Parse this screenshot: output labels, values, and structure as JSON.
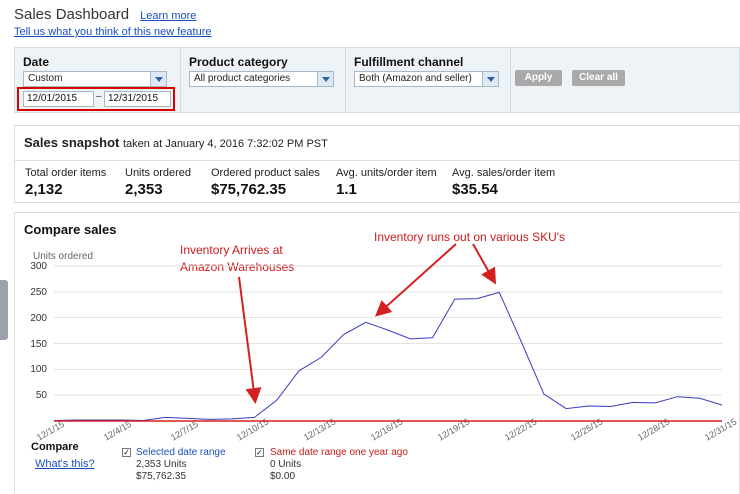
{
  "header": {
    "title": "Sales Dashboard",
    "learn_more": "Learn more",
    "feedback": "Tell us what you think of this new feature"
  },
  "filters": {
    "date": {
      "label": "Date",
      "selected": "Custom",
      "start": "12/01/2015",
      "separator": "–",
      "end": "12/31/2015"
    },
    "category": {
      "label": "Product category",
      "selected": "All product categories"
    },
    "fulfillment": {
      "label": "Fulfillment channel",
      "selected": "Both (Amazon and seller)"
    },
    "apply": "Apply",
    "clear": "Clear all"
  },
  "snapshot": {
    "title": "Sales snapshot",
    "taken": "taken at January 4, 2016 7:32:02 PM PST",
    "metrics": [
      {
        "label": "Total order items",
        "value": "2,132"
      },
      {
        "label": "Units ordered",
        "value": "2,353"
      },
      {
        "label": "Ordered product sales",
        "value": "$75,762.35"
      },
      {
        "label": "Avg. units/order item",
        "value": "1.1"
      },
      {
        "label": "Avg. sales/order item",
        "value": "$35.54"
      }
    ]
  },
  "compare": {
    "title": "Compare sales",
    "label": "Compare",
    "whats_this": "What's this?",
    "selected": {
      "name": "Selected date range",
      "units": "2,353 Units",
      "sales": "$75,762.35"
    },
    "last_year": {
      "name": "Same date range one year ago",
      "units": "0 Units",
      "sales": "$0.00"
    }
  },
  "annotations": {
    "arrives_line1": "Inventory Arrives at",
    "arrives_line2": "Amazon Warehouses",
    "runs_out": "Inventory runs out on various SKU's"
  },
  "colors": {
    "selected": "#3b3bc0",
    "last_year": "#d42020",
    "annotation": "#cc1a1a",
    "link": "#1a4ec0"
  },
  "chart_data": {
    "type": "line",
    "ylabel": "Units ordered",
    "ylim": [
      0,
      300
    ],
    "yticks": [
      50,
      100,
      150,
      200,
      250,
      300
    ],
    "xtick_labels": [
      "12/1/15",
      "12/4/15",
      "12/7/15",
      "12/10/15",
      "12/13/15",
      "12/16/15",
      "12/19/15",
      "12/22/15",
      "12/25/15",
      "12/28/15",
      "12/31/15"
    ],
    "x": [
      "12/1",
      "12/2",
      "12/3",
      "12/4",
      "12/5",
      "12/6",
      "12/7",
      "12/8",
      "12/9",
      "12/10",
      "12/11",
      "12/12",
      "12/13",
      "12/14",
      "12/15",
      "12/16",
      "12/17",
      "12/18",
      "12/19",
      "12/20",
      "12/21",
      "12/22",
      "12/23",
      "12/24",
      "12/25",
      "12/26",
      "12/27",
      "12/28",
      "12/29",
      "12/30",
      "12/31"
    ],
    "grid": "horizontal",
    "series": [
      {
        "name": "Selected date range",
        "values": [
          1,
          2,
          2,
          2,
          1,
          7,
          5,
          3,
          4,
          7,
          40,
          97,
          123,
          167,
          191,
          176,
          159,
          161,
          236,
          237,
          249,
          152,
          52,
          24,
          29,
          28,
          36,
          35,
          47,
          44,
          31
        ]
      },
      {
        "name": "Same date range one year ago",
        "values": [
          0,
          0,
          0,
          0,
          0,
          0,
          0,
          0,
          0,
          0,
          0,
          0,
          0,
          0,
          0,
          0,
          0,
          0,
          0,
          0,
          0,
          0,
          0,
          0,
          0,
          0,
          0,
          0,
          0,
          0,
          0
        ]
      }
    ]
  }
}
